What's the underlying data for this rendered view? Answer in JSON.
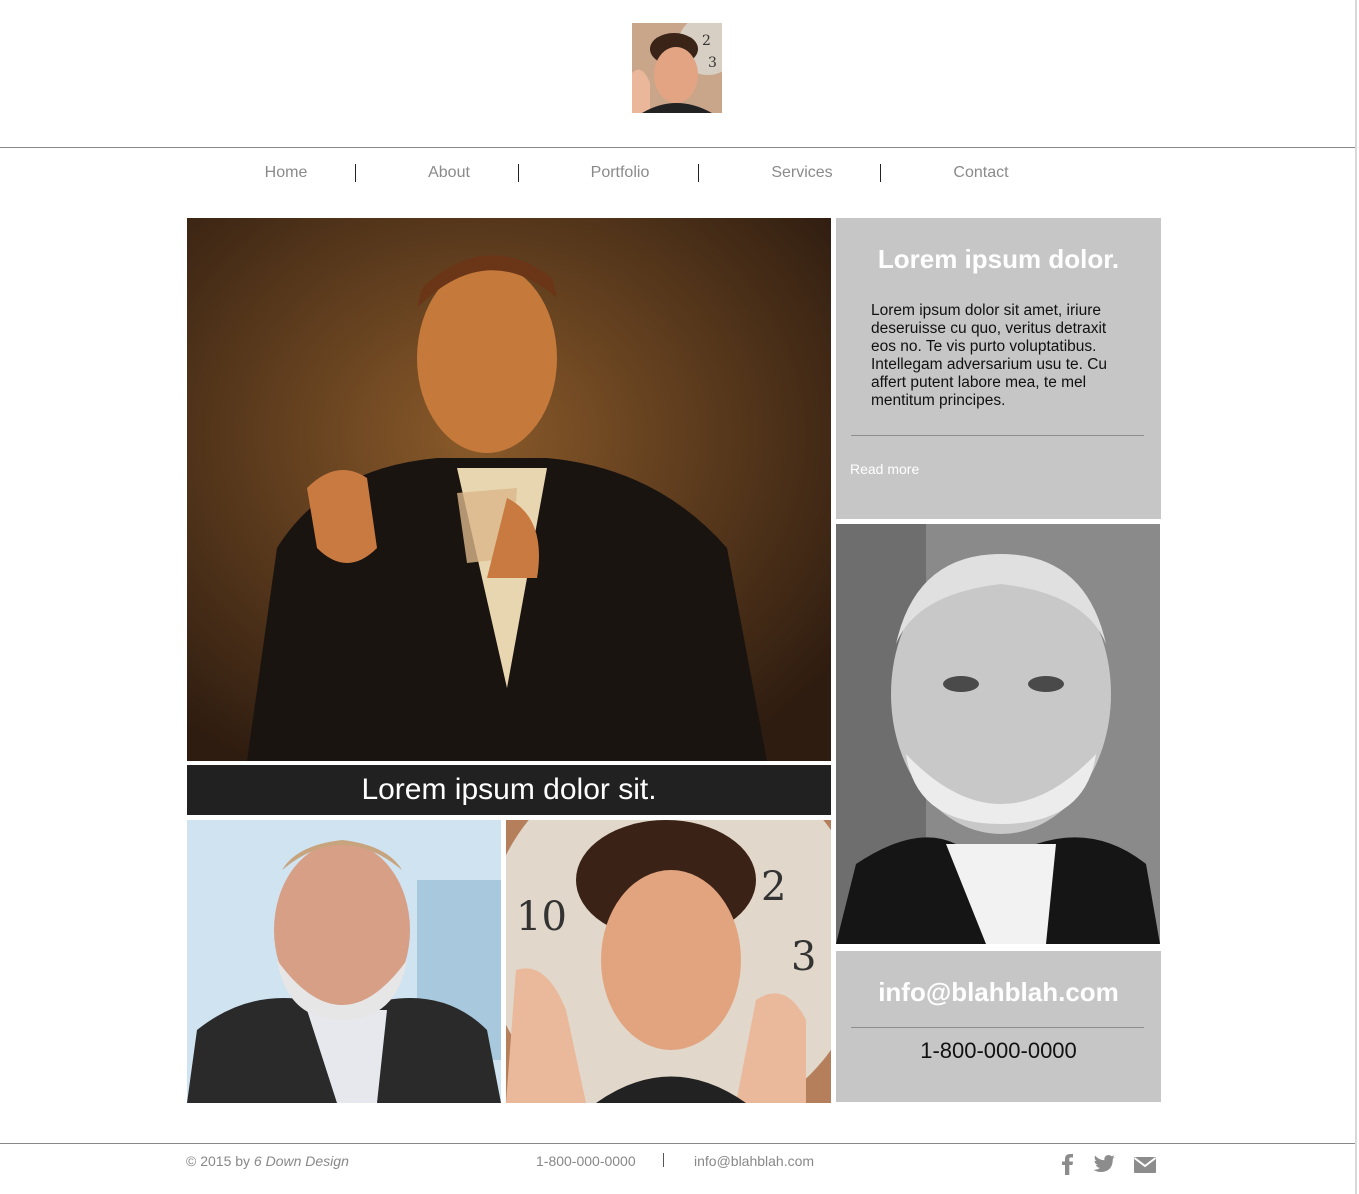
{
  "header": {
    "logo_icon": "portrait-logo-icon"
  },
  "nav": {
    "items": [
      {
        "label": "Home"
      },
      {
        "label": "About"
      },
      {
        "label": "Portfolio"
      },
      {
        "label": "Services"
      },
      {
        "label": "Contact"
      }
    ]
  },
  "gallery": {
    "main_photo_icon": "portrait-toast-photo",
    "caption": "Lorem ipsum dolor sit.",
    "bottom_left_photo_icon": "portrait-bearded-photo",
    "bottom_right_photo_icon": "portrait-clock-photo",
    "right_photo_icon": "portrait-bw-photo"
  },
  "feature": {
    "title": "Lorem ipsum dolor.",
    "body": "Lorem ipsum dolor sit amet, iriure deseruisse cu quo, veritus detraxit eos no. Te vis purto voluptatibus. Intellegam adversarium usu te. Cu affert putent labore mea, te mel mentitum principes.",
    "read_more": "Read more"
  },
  "contact": {
    "email": "info@blahblah.com",
    "phone": "1-800-000-0000"
  },
  "footer": {
    "copyright_prefix": "© 2015 by ",
    "copyright_brand": "6 Down Design",
    "phone": "1-800-000-0000",
    "email": "info@blahblah.com",
    "social": [
      {
        "icon": "facebook-icon"
      },
      {
        "icon": "twitter-icon"
      },
      {
        "icon": "mail-icon"
      }
    ]
  },
  "colors": {
    "panel_gray": "#c6c6c6",
    "caption_dark": "#212121",
    "nav_text": "#8a8a8a"
  }
}
